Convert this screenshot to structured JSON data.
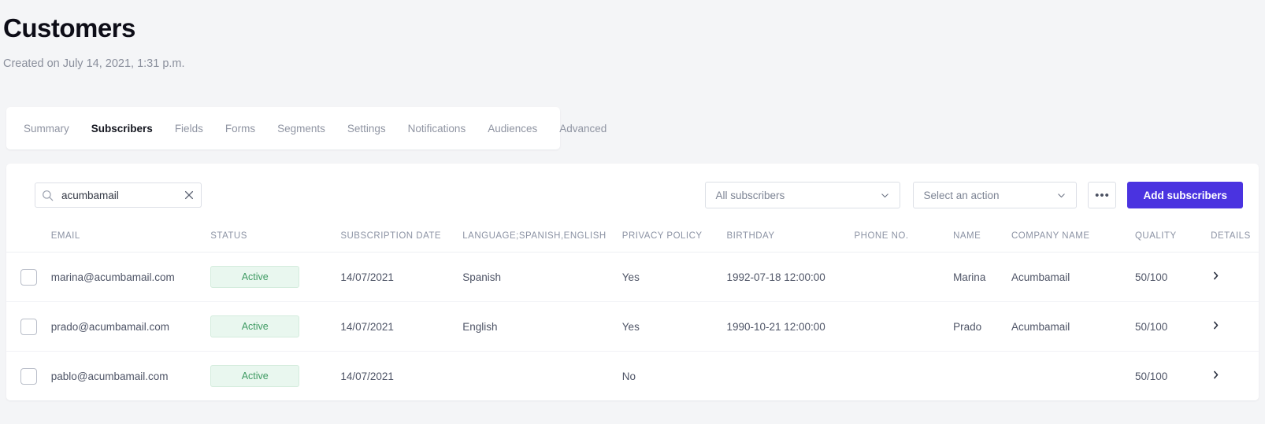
{
  "header": {
    "title": "Customers",
    "subtitle": "Created on July 14, 2021, 1:31 p.m."
  },
  "tabs": [
    {
      "label": "Summary",
      "active": false
    },
    {
      "label": "Subscribers",
      "active": true
    },
    {
      "label": "Fields",
      "active": false
    },
    {
      "label": "Forms",
      "active": false
    },
    {
      "label": "Segments",
      "active": false
    },
    {
      "label": "Settings",
      "active": false
    },
    {
      "label": "Notifications",
      "active": false
    },
    {
      "label": "Audiences",
      "active": false
    },
    {
      "label": "Advanced",
      "active": false
    }
  ],
  "toolbar": {
    "search_value": "acumbamail",
    "search_placeholder": "",
    "search_icon": "search-icon",
    "clear_icon": "close-icon",
    "subscribers_filter": "All subscribers",
    "action_select": "Select an action",
    "more_label": "•••",
    "add_button": "Add subscribers",
    "accent_color": "#4a33e0"
  },
  "table": {
    "columns": [
      "EMAIL",
      "STATUS",
      "SUBSCRIPTION DATE",
      "LANGUAGE;SPANISH,ENGLISH",
      "PRIVACY POLICY",
      "BIRTHDAY",
      "PHONE NO.",
      "NAME",
      "COMPANY NAME",
      "QUALITY",
      "DETAILS"
    ],
    "rows": [
      {
        "email": "marina@acumbamail.com",
        "status": "Active",
        "subscription_date": "14/07/2021",
        "language": "Spanish",
        "privacy_policy": "Yes",
        "birthday": "1992-07-18 12:00:00",
        "phone": "",
        "name": "Marina",
        "company": "Acumbamail",
        "quality": "50/100",
        "details_icon": "chevron-right-icon"
      },
      {
        "email": "prado@acumbamail.com",
        "status": "Active",
        "subscription_date": "14/07/2021",
        "language": "English",
        "privacy_policy": "Yes",
        "birthday": "1990-10-21 12:00:00",
        "phone": "",
        "name": "Prado",
        "company": "Acumbamail",
        "quality": "50/100",
        "details_icon": "chevron-right-icon"
      },
      {
        "email": "pablo@acumbamail.com",
        "status": "Active",
        "subscription_date": "14/07/2021",
        "language": "",
        "privacy_policy": "No",
        "birthday": "",
        "phone": "",
        "name": "",
        "company": "",
        "quality": "50/100",
        "details_icon": "chevron-right-icon"
      }
    ],
    "status_badge_colors": {
      "text": "#3f9b63",
      "background": "#e9f7ef",
      "border": "#d4ecdd"
    }
  }
}
